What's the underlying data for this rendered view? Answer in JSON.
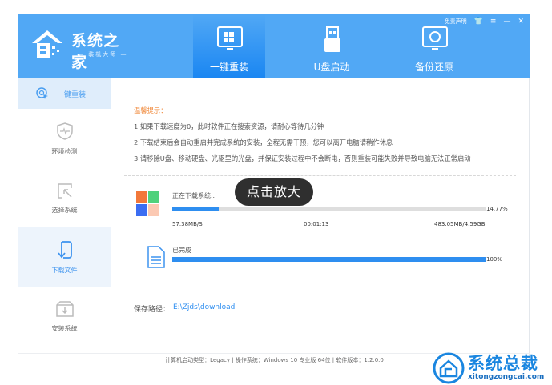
{
  "header": {
    "logo_title": "系统之家",
    "logo_subtitle": "— 装机大师 —",
    "disclaimer": "免责声明",
    "tabs": [
      {
        "label": "一键重装"
      },
      {
        "label": "U盘启动"
      },
      {
        "label": "备份还原"
      }
    ]
  },
  "sidebar": {
    "top_label": "一键重装",
    "items": [
      {
        "label": "环境检测"
      },
      {
        "label": "选择系统"
      },
      {
        "label": "下载文件"
      },
      {
        "label": "安装系统"
      }
    ]
  },
  "tips": {
    "heading": "温馨提示：",
    "lines": [
      "1.如果下载速度为0，此时软件正在搜索资源，请耐心等待几分钟",
      "2.下载结束后会自动重启并完成系统的安装，全程无需干预，您可以离开电脑请稍作休息",
      "3.请移除U盘、移动硬盘、光驱里的光盘，并保证安装过程中不会断电，否则重装可能失败并导致电脑无法正常启动"
    ]
  },
  "download": {
    "status": "正在下载系统...",
    "percent_label": "14.77%",
    "percent": 14.77,
    "speed": "57.38MB/S",
    "elapsed": "00:01:13",
    "size": "483.05MB/4.59GB"
  },
  "complete": {
    "status": "已完成",
    "percent_label": "100%",
    "percent": 100
  },
  "save_path": {
    "label": "保存路径：",
    "value": "E:\\Zjds\\download"
  },
  "tooltip": "点击放大",
  "footer": "计算机启动类型：Legacy | 操作系统：Windows 10 专业版 64位 | 软件版本：1.2.0.0",
  "watermark": {
    "title": "系统总裁",
    "url": "xitongzongcai.com"
  }
}
